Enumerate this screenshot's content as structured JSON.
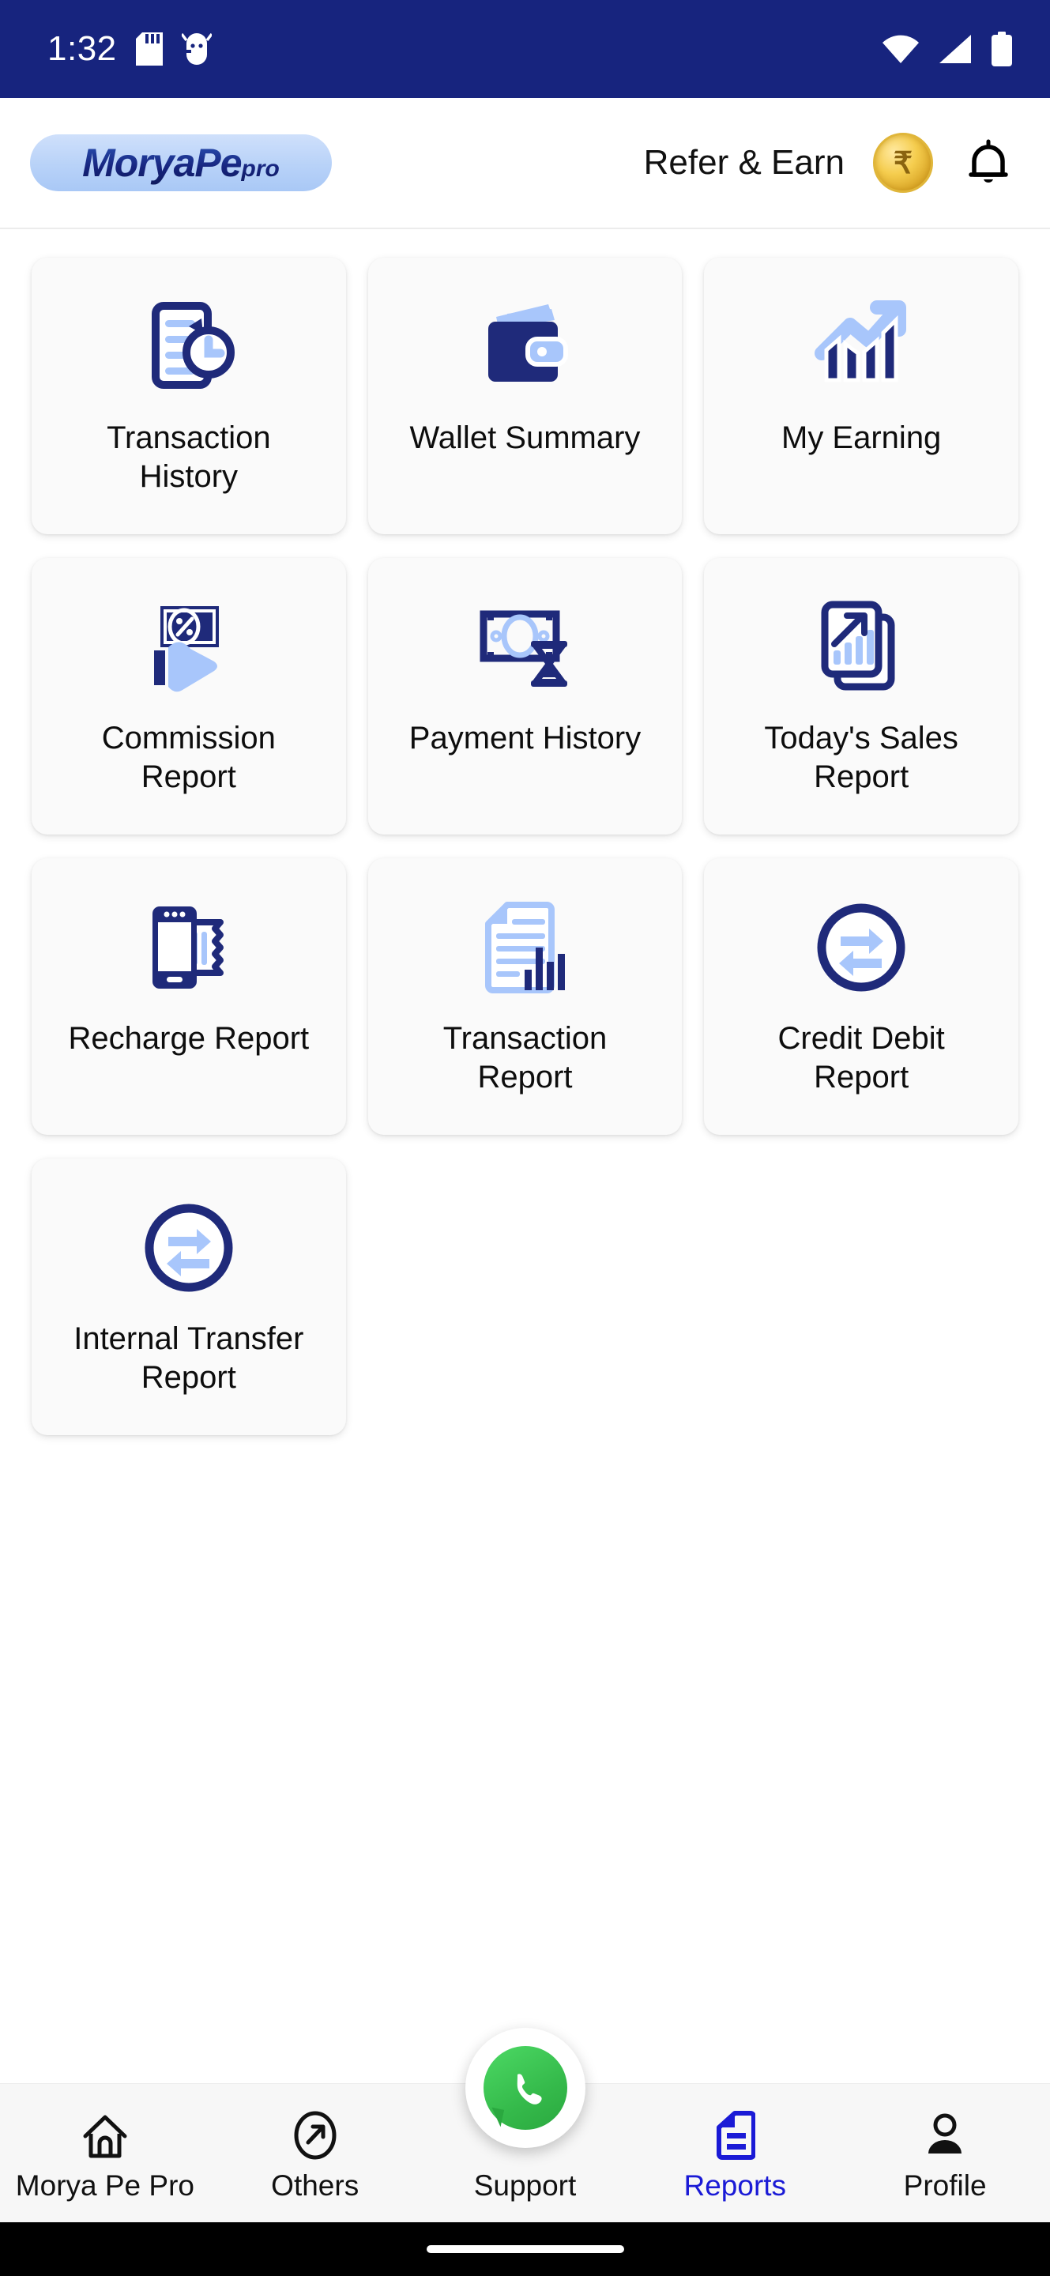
{
  "status_bar": {
    "time": "1:32",
    "left_icons": [
      "sd-card-icon",
      "android-debug-icon"
    ],
    "right_icons": [
      "wifi-icon",
      "cellular-signal-icon",
      "battery-icon"
    ],
    "background_color": "#17247E"
  },
  "header": {
    "logo_main": "MoryaPe",
    "logo_suffix": "pro",
    "refer_label": "Refer & Earn",
    "coin_symbol": "₹",
    "coin_icon": "rupee-coin-icon",
    "bell_icon": "notification-bell-icon"
  },
  "reports_grid": {
    "cards": [
      {
        "label": "Transaction History",
        "icon": "document-history-icon"
      },
      {
        "label": "Wallet Summary",
        "icon": "wallet-icon"
      },
      {
        "label": "My Earning",
        "icon": "growth-chart-icon"
      },
      {
        "label": "Commission Report",
        "icon": "hand-percent-money-icon"
      },
      {
        "label": "Payment History",
        "icon": "banknote-hourglass-icon"
      },
      {
        "label": "Today's Sales Report",
        "icon": "sales-documents-icon"
      },
      {
        "label": "Recharge Report",
        "icon": "phone-receipt-icon"
      },
      {
        "label": "Transaction Report",
        "icon": "document-barchart-icon"
      },
      {
        "label": "Credit Debit Report",
        "icon": "transfer-arrows-circle-icon"
      },
      {
        "label": "Internal Transfer Report",
        "icon": "transfer-arrows-circle-icon"
      }
    ]
  },
  "floating_action": {
    "label": "whatsapp-support",
    "icon": "whatsapp-icon",
    "color": "#35BA4B"
  },
  "bottom_nav": {
    "items": [
      {
        "label": "Morya Pe Pro",
        "icon": "home-icon",
        "active": false
      },
      {
        "label": "Others",
        "icon": "arrow-circle-icon",
        "active": false
      },
      {
        "label": "Support",
        "icon": "whatsapp-icon",
        "active": false
      },
      {
        "label": "Reports",
        "icon": "report-document-icon",
        "active": true
      },
      {
        "label": "Profile",
        "icon": "person-icon",
        "active": false
      }
    ],
    "active_color": "#1A1AD6"
  },
  "colors": {
    "status_bar": "#17247E",
    "icon_navy": "#1F2A7A",
    "icon_light_blue": "#A8C6FB",
    "card_bg": "#FAFAFA",
    "page_bg": "#FFFFFF"
  }
}
